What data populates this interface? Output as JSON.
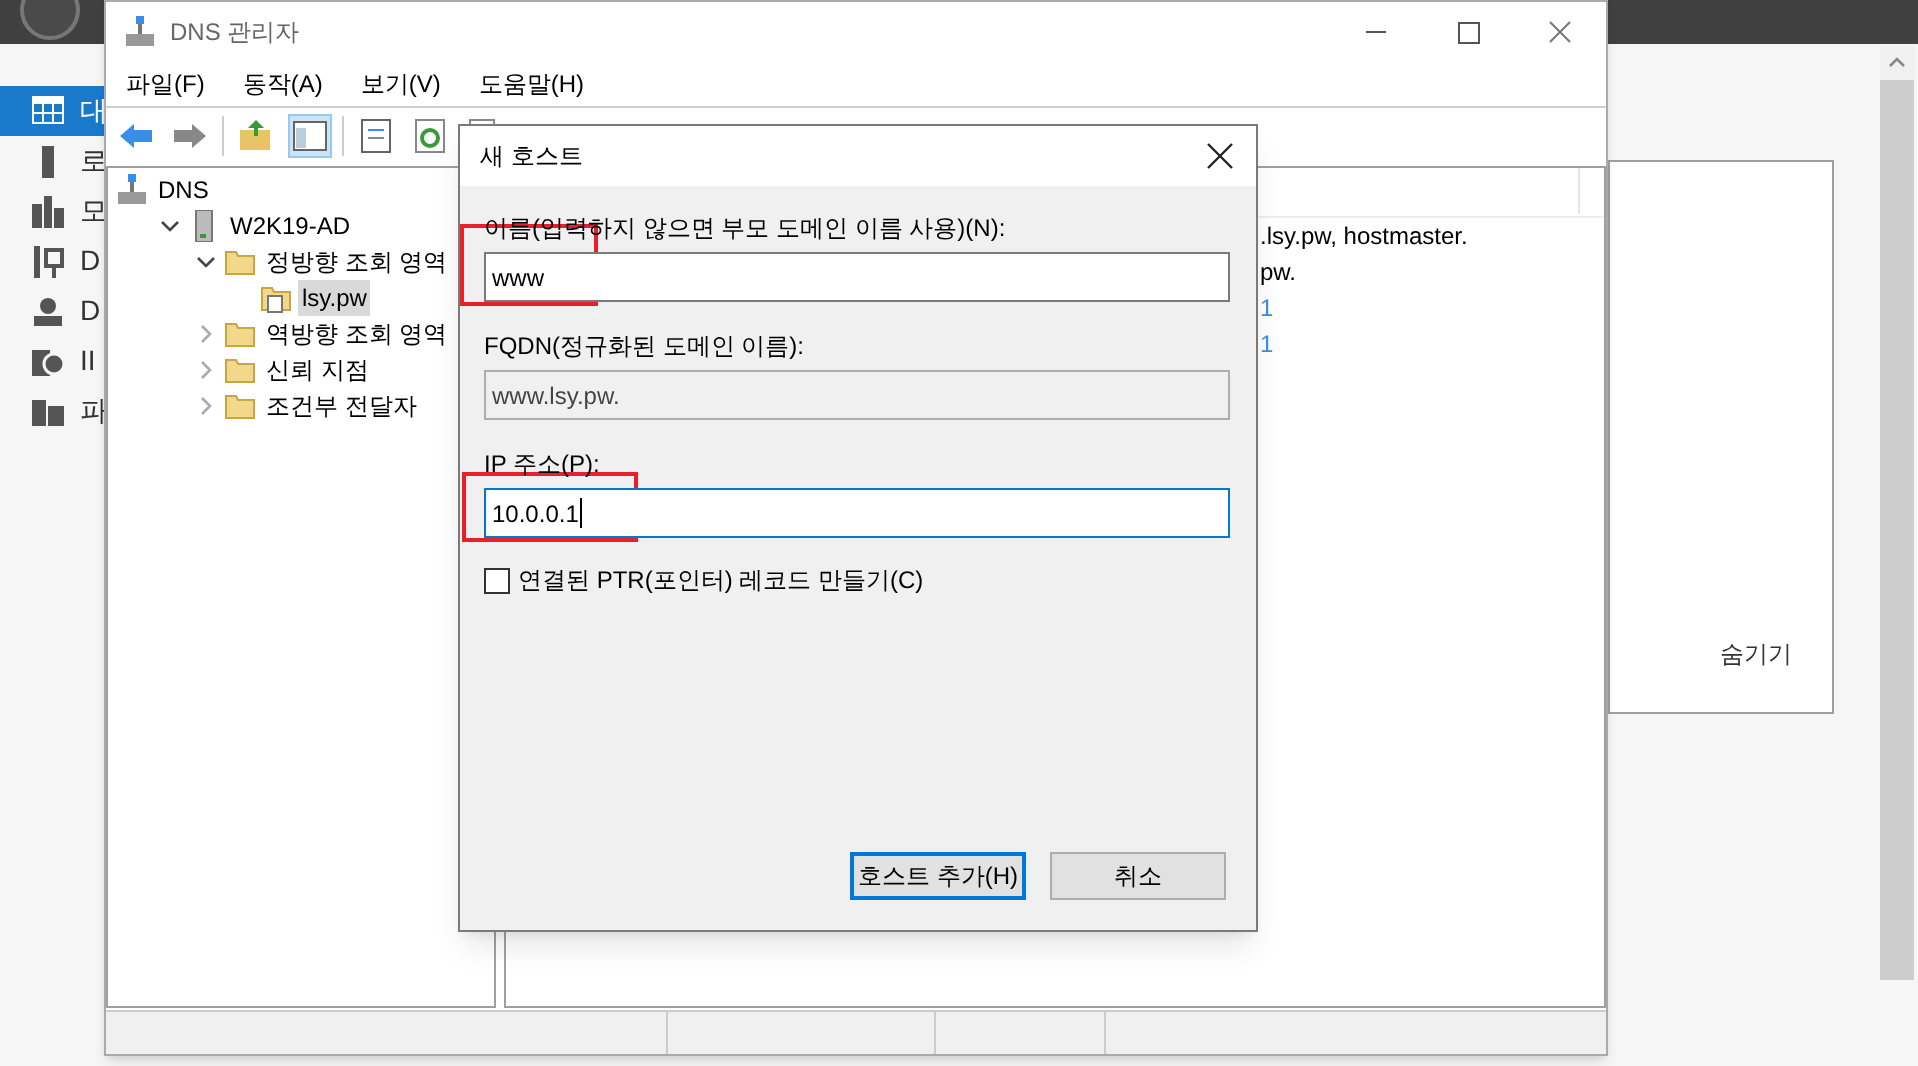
{
  "server_manager": {
    "sidebar_items": [
      {
        "label": "대",
        "selected": true,
        "kind": "dashboard"
      },
      {
        "label": "로",
        "selected": false,
        "kind": "server"
      },
      {
        "label": "모",
        "selected": false,
        "kind": "servers"
      },
      {
        "label": "D",
        "selected": false,
        "kind": "tools"
      },
      {
        "label": "D",
        "selected": false,
        "kind": "dns"
      },
      {
        "label": "II",
        "selected": false,
        "kind": "iis"
      },
      {
        "label": "파",
        "selected": false,
        "kind": "files"
      }
    ],
    "side_panel": {
      "link": "숨기기"
    }
  },
  "window": {
    "title": "DNS 관리자"
  },
  "menu": [
    "파일(F)",
    "동작(A)",
    "보기(V)",
    "도움말(H)"
  ],
  "toolbar": [
    {
      "kind": "back",
      "selected": false
    },
    {
      "kind": "forward",
      "selected": false
    },
    {
      "kind": "up",
      "selected": false
    },
    {
      "kind": "tree",
      "selected": true
    },
    {
      "kind": "properties",
      "selected": false
    },
    {
      "kind": "refresh",
      "selected": false
    },
    {
      "kind": "export",
      "selected": false
    }
  ],
  "tree": [
    {
      "label": "DNS",
      "kind": "dns",
      "selected": false,
      "children": [
        {
          "label": "W2K19-AD",
          "kind": "server",
          "expanded": true,
          "selected": false,
          "children": [
            {
              "label": "정방향 조회 영역",
              "kind": "folder",
              "expanded": true,
              "selected": false,
              "children": [
                {
                  "label": "lsy.pw",
                  "kind": "zone",
                  "selected": true
                }
              ]
            },
            {
              "label": "역방향 조회 영역",
              "kind": "folder",
              "expanded": false,
              "selected": false
            },
            {
              "label": "신뢰 지점",
              "kind": "folder",
              "expanded": false,
              "selected": false
            },
            {
              "label": "조건부 전달자",
              "kind": "folder",
              "expanded": false,
              "selected": false
            }
          ]
        }
      ]
    }
  ],
  "details": {
    "lines": [
      {
        "text": ".lsy.pw, hostmaster.",
        "color": "#000000"
      },
      {
        "text": "pw.",
        "color": "#000000"
      },
      {
        "text": "1",
        "color": "#3a8ee6"
      },
      {
        "text": "1",
        "color": "#3a8ee6"
      }
    ]
  },
  "dialog": {
    "title": "새 호스트",
    "name_field": {
      "label": "이름(입력하지 않으면 부모 도메인 이름 사용)(N):",
      "value": "www",
      "highlighted": true,
      "focused": false
    },
    "fqdn_field": {
      "label": "FQDN(정규화된 도메인 이름):",
      "value": "www.lsy.pw.",
      "disabled": true
    },
    "ip_field": {
      "label": "IP 주소(P):",
      "value": "10.0.0.1",
      "highlighted": true,
      "focused": true
    },
    "ptr_checkbox": {
      "label": "연결된 PTR(포인터) 레코드 만들기(C)",
      "checked": false
    },
    "buttons": [
      {
        "label": "호스트 추가(H)",
        "default": true
      },
      {
        "label": "취소",
        "default": false
      }
    ]
  }
}
